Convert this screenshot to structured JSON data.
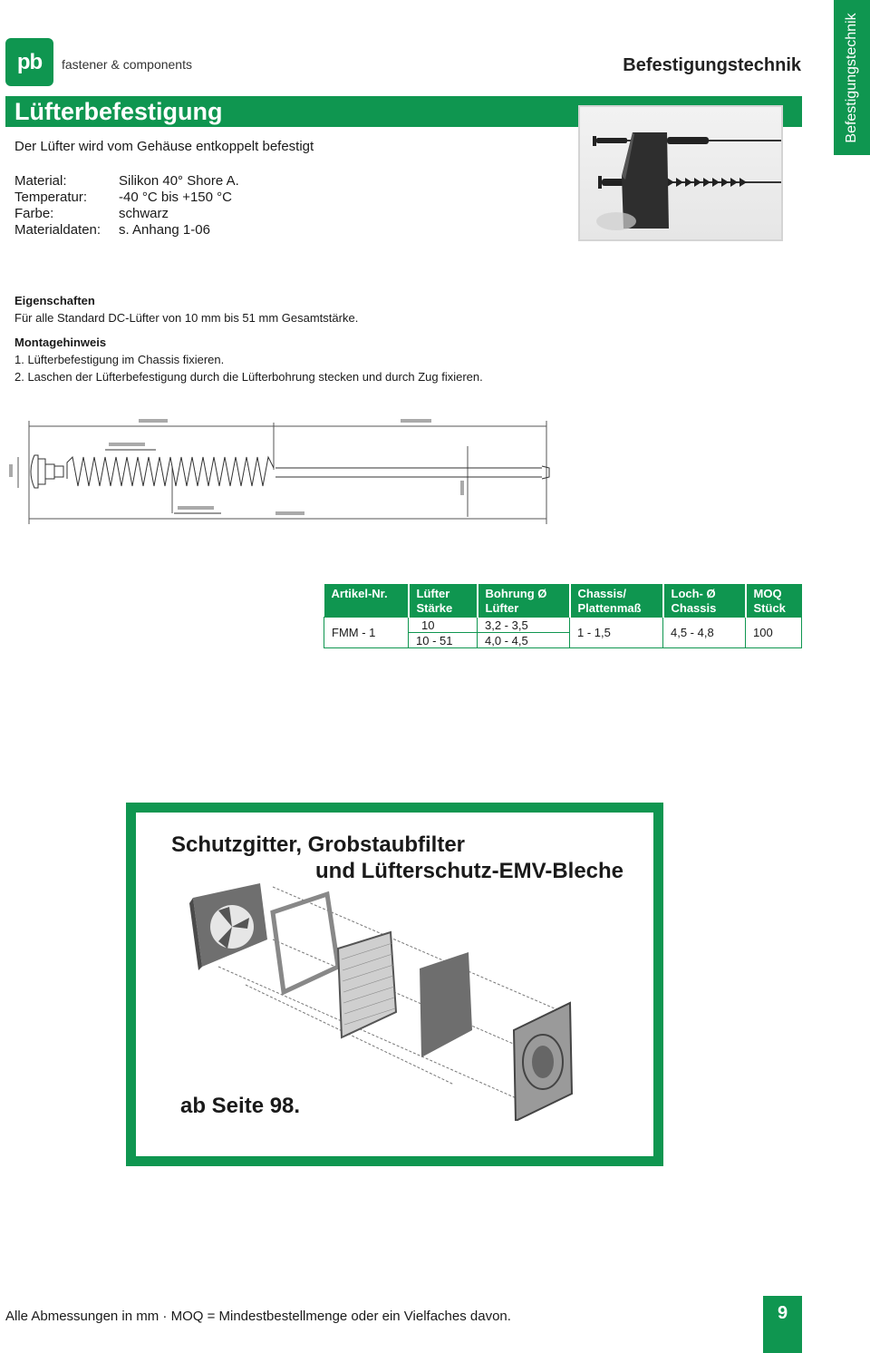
{
  "brand": {
    "logo_text": "pb",
    "tagline": "fastener & components"
  },
  "header": {
    "section": "Befestigungstechnik",
    "side_tab": "Befestigungstechnik"
  },
  "product": {
    "title": "Lüfterbefestigung",
    "subtitle": "Der Lüfter wird vom Gehäuse entkoppelt befestigt",
    "photo_alt": "fan-mount-photo"
  },
  "specs": [
    {
      "label": "Material:",
      "value": "Silikon 40° Shore A."
    },
    {
      "label": "Temperatur:",
      "value": "-40 °C bis +150 °C"
    },
    {
      "label": "Farbe:",
      "value": "schwarz"
    },
    {
      "label": "Materialdaten:",
      "value": "s. Anhang 1-06"
    }
  ],
  "properties": {
    "heading": "Eigenschaften",
    "text": "Für alle Standard DC-Lüfter von 10 mm bis 51 mm Gesamtstärke."
  },
  "assembly": {
    "heading": "Montagehinweis",
    "steps": [
      "1. Lüfterbefestigung im Chassis fixieren.",
      "2. Laschen der Lüfterbefestigung durch die Lüfterbohrung stecken und durch Zug fixieren."
    ]
  },
  "table": {
    "headers": [
      [
        "Artikel-Nr.",
        ""
      ],
      [
        "Lüfter",
        "Stärke"
      ],
      [
        "Bohrung Ø",
        "Lüfter"
      ],
      [
        "Chassis/",
        "Plattenmaß"
      ],
      [
        "Loch-  Ø",
        "Chassis"
      ],
      [
        "MOQ",
        "Stück"
      ]
    ],
    "rows": [
      {
        "article": "FMM - 1",
        "sub_rows": [
          {
            "fan_thickness": "10",
            "fan_bore": "3,2 - 3,5"
          },
          {
            "fan_thickness": "10 - 51",
            "fan_bore": "4,0 - 4,5"
          }
        ],
        "chassis_thickness": "1 - 1,5",
        "chassis_hole": "4,5 - 4,8",
        "moq": "100"
      }
    ]
  },
  "promo": {
    "title_line1": "Schutzgitter, Grobstaubfilter",
    "title_line2": "und Lüfterschutz-EMV-Bleche",
    "link": "ab Seite 98."
  },
  "footer": {
    "note": "Alle Abmessungen in mm · MOQ = Mindestbestellmenge oder ein Vielfaches davon.",
    "page_number": "9"
  },
  "colors": {
    "brand_green": "#0f9650"
  }
}
